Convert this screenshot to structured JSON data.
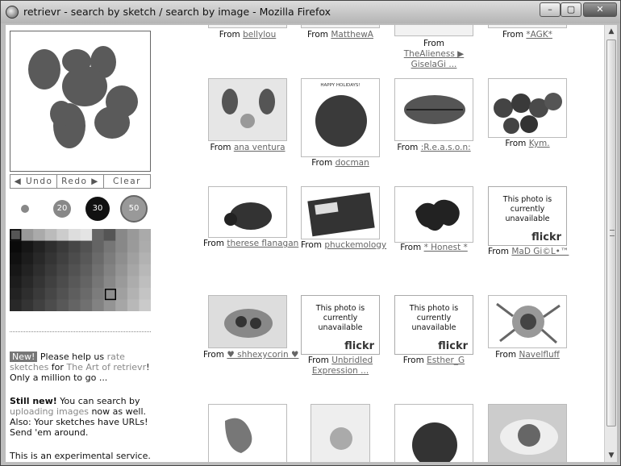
{
  "window": {
    "title": "retrievr - search by sketch / search by image - Mozilla Firefox",
    "controls": {
      "minimize": "–",
      "maximize": "▢",
      "close": "✕"
    }
  },
  "sketch_tools": {
    "undo": "◀ Undo",
    "redo": "Redo ▶",
    "clear": "Clear"
  },
  "brush_sizes": [
    "",
    "20",
    "30",
    "50"
  ],
  "info": {
    "new_badge": "New!",
    "line1_a": " Please help us ",
    "line1_link": "rate sketches",
    "line1_b": " for ",
    "line1_link2": "The Art of retrievr",
    "line1_c": "! Only a million to go ...",
    "still_new": "Still new!",
    "line2_a": " You can search by ",
    "line2_link": "uploading images",
    "line2_b": " now as well. Also: Your sketches have URLs! Send 'em around.",
    "line3": "This is an experimental service."
  },
  "results": {
    "from_label": "From",
    "top_row": [
      "bellylou",
      "MatthewA",
      "TheAlieness ▶ GiselaGi ...",
      "*AGK*"
    ],
    "row1": [
      "ana ventura",
      "docman",
      ":R.e.a.s.o.n:",
      "Kym."
    ],
    "row2": [
      "therese flanagan",
      "phuckemology",
      "* Honest *",
      "MaD Gi©L•™"
    ],
    "row3": [
      "♥ shhexycorin ♥",
      "Unbridled Expression ...",
      "Esther_G",
      "Navelfluff"
    ],
    "unavailable_text": "This photo is currently unavailable",
    "flickr_logo": "flickr",
    "happy_holidays": "HAPPY HOLIDAYS!"
  }
}
